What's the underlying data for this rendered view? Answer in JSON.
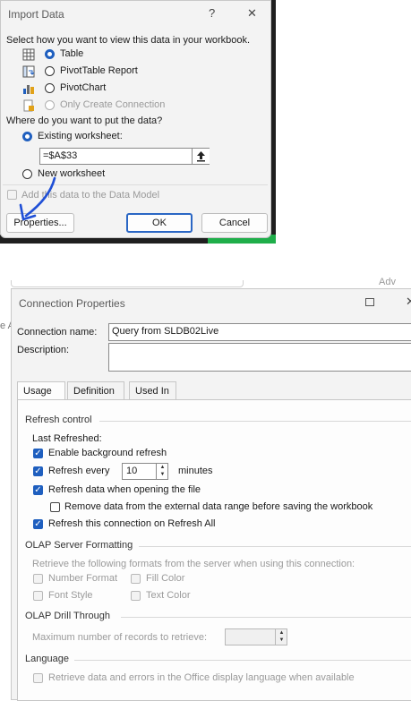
{
  "import_dialog": {
    "title": "Import Data",
    "help_glyph": "?",
    "close_glyph": "✕",
    "view_prompt": "Select how you want to view this data in your workbook.",
    "view_options": [
      {
        "label": "Table",
        "selected": true,
        "enabled": true,
        "icon": "table-icon"
      },
      {
        "label": "PivotTable Report",
        "selected": false,
        "enabled": true,
        "icon": "pivottable-icon"
      },
      {
        "label": "PivotChart",
        "selected": false,
        "enabled": true,
        "icon": "pivotchart-icon"
      },
      {
        "label": "Only Create Connection",
        "selected": false,
        "enabled": false,
        "icon": "connection-icon"
      }
    ],
    "put_prompt": "Where do you want to put the data?",
    "existing_label": "Existing worksheet:",
    "existing_selected": true,
    "range_value": "=$A$33",
    "new_label": "New worksheet",
    "data_model_label": "Add this data to the Data Model",
    "properties_button": "Properties...",
    "ok_button": "OK",
    "cancel_button": "Cancel"
  },
  "conn_dialog": {
    "title": "Connection Properties",
    "behind_text": "Adv",
    "behind_left": "e A",
    "name_label": "Connection name:",
    "name_value": "Query from SLDB02Live",
    "description_label": "Description:",
    "tabs": [
      "Usage",
      "Definition",
      "Used In"
    ],
    "refresh_control": {
      "heading": "Refresh control",
      "last_refreshed": "Last Refreshed:",
      "enable_background": "Enable background refresh",
      "refresh_every": "Refresh every",
      "refresh_minutes_value": "10",
      "minutes": "minutes",
      "refresh_on_open": "Refresh data when opening the file",
      "remove_data": "Remove data from the external data range before saving the workbook",
      "refresh_all": "Refresh this connection on Refresh All"
    },
    "olap_formatting": {
      "heading": "OLAP Server Formatting",
      "description": "Retrieve the following formats from the server when using this connection:",
      "number_format": "Number Format",
      "fill_color": "Fill Color",
      "font_style": "Font Style",
      "text_color": "Text Color"
    },
    "olap_drill": {
      "heading": "OLAP Drill Through",
      "max_records": "Maximum number of records to retrieve:"
    },
    "language": {
      "heading": "Language",
      "retrieve_lang": "Retrieve data and errors in the Office display language when available"
    }
  },
  "colors": {
    "accent": "#1f5fbf",
    "annotation_arrow": "#1f4fd6",
    "excel_green": "#1fae4a"
  }
}
